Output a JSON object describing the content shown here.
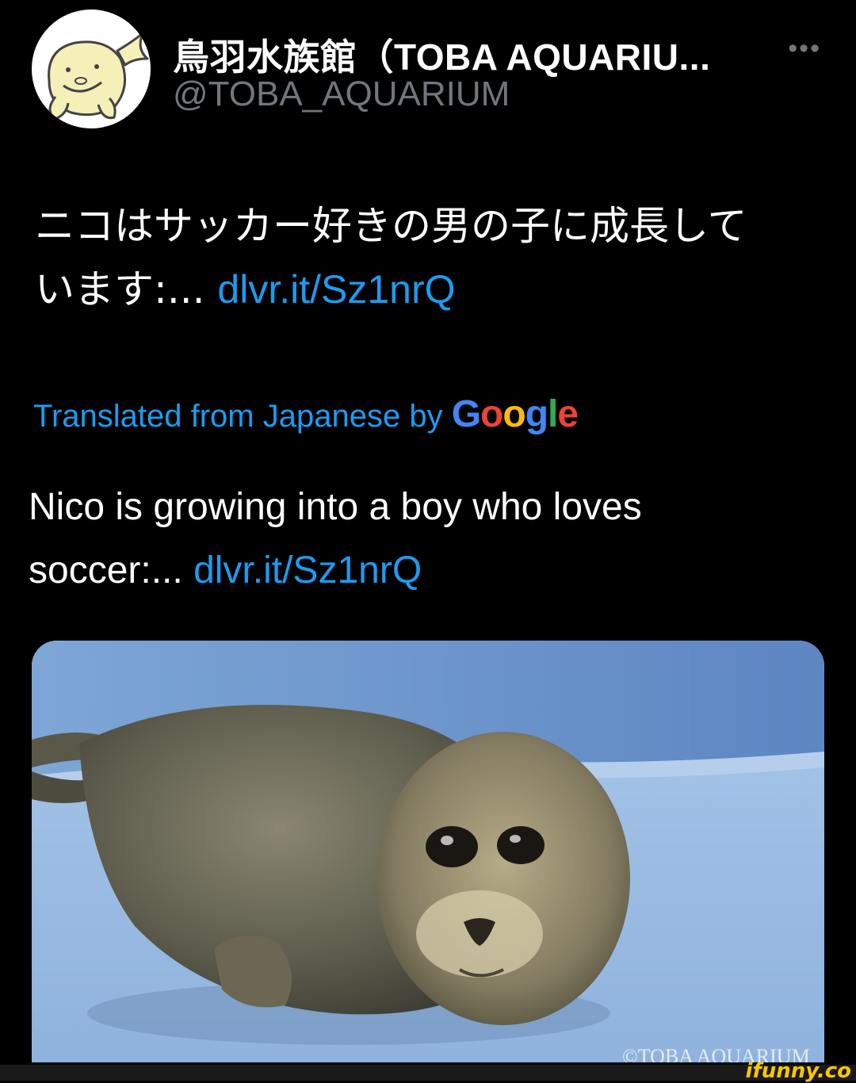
{
  "header": {
    "display_name": "鳥羽水族館（TOBA AQUARIU...",
    "handle": "@TOBA_AQUARIUM",
    "more_label": "•••"
  },
  "tweet": {
    "jp_line1": "ニコはサッカー好きの男の子に成長して",
    "jp_line2_prefix": "います:... ",
    "jp_link": "dlvr.it/Sz1nrQ",
    "translated_prefix": "Translated from Japanese by ",
    "google_label": "Google",
    "en_line1": "Nico is growing into a boy who loves",
    "en_line2_prefix": "soccer:... ",
    "en_link": "dlvr.it/Sz1nrQ"
  },
  "media": {
    "photo_watermark": "©TOBA AQUARIUM"
  },
  "footer": {
    "ifunny": "ifunny.co"
  },
  "colors": {
    "background": "#000000",
    "link": "#1d9bf0",
    "secondary": "#71767b",
    "google_blue": "#4285f4",
    "google_red": "#ea4335",
    "google_yellow": "#fbbc05",
    "google_green": "#34a853"
  }
}
